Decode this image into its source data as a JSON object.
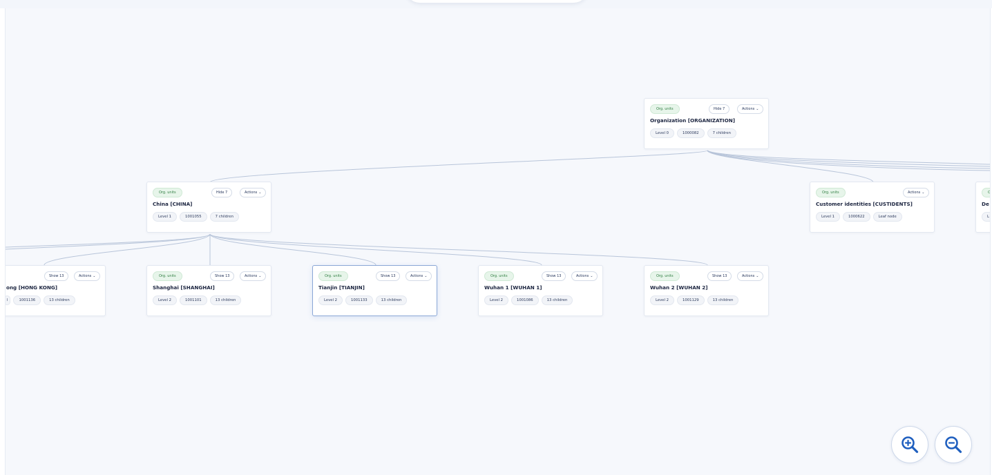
{
  "tree": {
    "nodes": [
      {
        "id": "organization",
        "tag": "Org. units",
        "title": "Organization [ORGANIZATION]",
        "level": "Level 0",
        "code": "1000082",
        "children": "7 children",
        "toggle": "Hide 7",
        "actions": "Actions"
      },
      {
        "id": "china",
        "tag": "Org. units",
        "title": "China [CHINA]",
        "level": "Level 1",
        "code": "1001055",
        "children": "7 children",
        "toggle": "Hide 7",
        "actions": "Actions"
      },
      {
        "id": "custidents",
        "tag": "Org. units",
        "title": "Customer identities [CUSTIDENTS]",
        "level": "Level 1",
        "code": "1000622",
        "children": "Leaf node",
        "actions": "Actions"
      },
      {
        "id": "de-partial",
        "tag": "O",
        "title": "De",
        "level": "L"
      },
      {
        "id": "hongkong",
        "tag": "nits",
        "title": "ong [HONG KONG]",
        "level": "l",
        "code": "1001136",
        "children": "13 children",
        "toggle": "Show 13",
        "actions": "Actions"
      },
      {
        "id": "shanghai",
        "tag": "Org. units",
        "title": "Shanghai [SHANGHAI]",
        "level": "Level 2",
        "code": "1001101",
        "children": "13 children",
        "toggle": "Show 13",
        "actions": "Actions"
      },
      {
        "id": "tianjin",
        "tag": "Org. units",
        "title": "Tianjin [TIANJIN]",
        "level": "Level 2",
        "code": "1001133",
        "children": "13 children",
        "toggle": "Show 13",
        "actions": "Actions",
        "selected": true
      },
      {
        "id": "wuhan1",
        "tag": "Org. units",
        "title": "Wuhan 1 [WUHAN 1]",
        "level": "Level 2",
        "code": "1001086",
        "children": "13 children",
        "toggle": "Show 13",
        "actions": "Actions"
      },
      {
        "id": "wuhan2",
        "tag": "Org. units",
        "title": "Wuhan 2 [WUHAN 2]",
        "level": "Level 2",
        "code": "1001129",
        "children": "13 children",
        "toggle": "Show 13",
        "actions": "Actions"
      }
    ]
  },
  "zoom": {
    "in_icon": "zoom-in-icon",
    "out_icon": "zoom-out-icon"
  },
  "colors": {
    "edge": "#b7c4d9",
    "tag_bg": "#e7f5ea",
    "tag_text": "#2e7d40",
    "accent": "#1f5fbf"
  }
}
